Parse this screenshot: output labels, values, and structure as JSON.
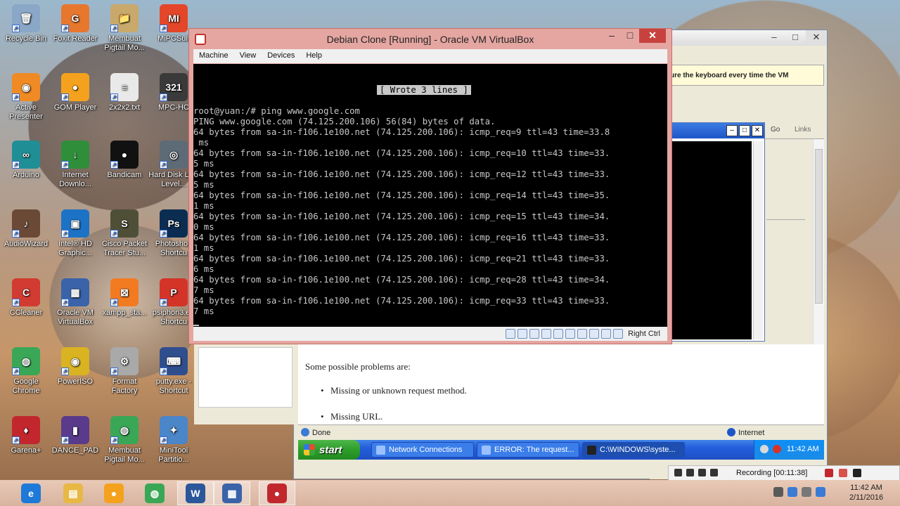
{
  "desktop": {
    "icons": [
      {
        "label": "Recycle Bin",
        "color": "#8aa7c7",
        "glyph": "🗑"
      },
      {
        "label": "Foxit Reader",
        "color": "#e8772e",
        "glyph": "G"
      },
      {
        "label": "Membuat Pigtail Mo...",
        "color": "#c9a96b",
        "glyph": "📁"
      },
      {
        "label": "MiPCSuit",
        "color": "#e4462a",
        "glyph": "MI"
      },
      {
        "label": "Active Presenter",
        "color": "#f08a24",
        "glyph": "◉"
      },
      {
        "label": "GOM Player",
        "color": "#f4a21d",
        "glyph": "●"
      },
      {
        "label": "2x2x2.txt",
        "color": "#e9e9e9",
        "glyph": "≡"
      },
      {
        "label": "MPC-HC",
        "color": "#3a3a3a",
        "glyph": "321"
      },
      {
        "label": "Arduino",
        "color": "#1f8f95",
        "glyph": "∞"
      },
      {
        "label": "Internet Downlo...",
        "color": "#2e8e3a",
        "glyph": "↓"
      },
      {
        "label": "Bandicam",
        "color": "#111111",
        "glyph": "●"
      },
      {
        "label": "Hard Disk Low Level...",
        "color": "#5d6b76",
        "glyph": "◎"
      },
      {
        "label": "AudioWizard",
        "color": "#6a4a36",
        "glyph": "♪"
      },
      {
        "label": "Intel® HD Graphic...",
        "color": "#1c73c5",
        "glyph": "▣"
      },
      {
        "label": "Cisco Packet Tracer Stu...",
        "color": "#4f4f38",
        "glyph": "S"
      },
      {
        "label": "Photoshop Shortcu",
        "color": "#0b2d52",
        "glyph": "Ps"
      },
      {
        "label": "CCleaner",
        "color": "#d13b31",
        "glyph": "C"
      },
      {
        "label": "Oracle VM VirtualBox",
        "color": "#3a63a9",
        "glyph": "▦"
      },
      {
        "label": "xampp_sta...",
        "color": "#f27b22",
        "glyph": "⊠"
      },
      {
        "label": "psiphon3.e - Shortcu",
        "color": "#d43428",
        "glyph": "P"
      },
      {
        "label": "Google Chrome",
        "color": "#3aa757",
        "glyph": "◍"
      },
      {
        "label": "PowerISO",
        "color": "#d9b321",
        "glyph": "◉"
      },
      {
        "label": "Format Factory",
        "color": "#a9a9a9",
        "glyph": "⚙"
      },
      {
        "label": "putty.exe - Shortcut",
        "color": "#2f4e8e",
        "glyph": "⌨"
      },
      {
        "label": "Garena+",
        "color": "#c1272d",
        "glyph": "♦"
      },
      {
        "label": "DANCE_PAD",
        "color": "#5a3a8a",
        "glyph": "▮"
      },
      {
        "label": "Membuat Pigtail Mo...",
        "color": "#3aa757",
        "glyph": "◍"
      },
      {
        "label": "MiniTool Partitio...",
        "color": "#4a86c8",
        "glyph": "✦"
      }
    ]
  },
  "vbox": {
    "title": "Debian Clone [Running] - Oracle VM VirtualBox",
    "menu": [
      "Machine",
      "View",
      "Devices",
      "Help"
    ],
    "wrote": "[ Wrote 3 lines ]",
    "console_lines": [
      "root@yuan:/# ping www.google.com",
      "PING www.google.com (74.125.200.106) 56(84) bytes of data.",
      "64 bytes from sa-in-f106.1e100.net (74.125.200.106): icmp_req=9 ttl=43 time=33.8",
      " ms",
      "64 bytes from sa-in-f106.1e100.net (74.125.200.106): icmp_req=10 ttl=43 time=33.",
      "5 ms",
      "64 bytes from sa-in-f106.1e100.net (74.125.200.106): icmp_req=12 ttl=43 time=33.",
      "5 ms",
      "64 bytes from sa-in-f106.1e100.net (74.125.200.106): icmp_req=14 ttl=43 time=35.",
      "1 ms",
      "64 bytes from sa-in-f106.1e100.net (74.125.200.106): icmp_req=15 ttl=43 time=34.",
      "0 ms",
      "64 bytes from sa-in-f106.1e100.net (74.125.200.106): icmp_req=16 ttl=43 time=33.",
      "1 ms",
      "64 bytes from sa-in-f106.1e100.net (74.125.200.106): icmp_req=21 ttl=43 time=33.",
      "6 ms",
      "64 bytes from sa-in-f106.1e100.net (74.125.200.106): icmp_req=28 ttl=43 time=34.",
      "7 ms",
      "64 bytes from sa-in-f106.1e100.net (74.125.200.106): icmp_req=33 ttl=43 time=33.",
      "7 ms"
    ],
    "host_key": "Right Ctrl"
  },
  "background_window": {
    "infobar_text": "ure the keyboard every time the VM",
    "go": "Go",
    "links": "Links",
    "page_intro": "Some possible problems are:",
    "page_items": [
      "Missing or unknown request method.",
      "Missing URL."
    ],
    "status_done": "Done",
    "status_zone": "Internet"
  },
  "xp_taskbar": {
    "start": "start",
    "tasks": [
      "Network Connections",
      "ERROR: The request...",
      "C:\\WINDOWS\\syste..."
    ],
    "time": "11:42 AM"
  },
  "recording": {
    "label": "Recording [00:11:38]"
  },
  "win_taskbar": {
    "apps": [
      {
        "name": "IE",
        "color": "#1e7ad8",
        "glyph": "e"
      },
      {
        "name": "Explorer",
        "color": "#e8b844",
        "glyph": "▤"
      },
      {
        "name": "GOM",
        "color": "#f4a21d",
        "glyph": "●"
      },
      {
        "name": "Chrome",
        "color": "#3aa757",
        "glyph": "◍"
      },
      {
        "name": "Word",
        "color": "#2b579a",
        "glyph": "W"
      },
      {
        "name": "VirtualBox",
        "color": "#3a63a9",
        "glyph": "▦"
      },
      {
        "name": "Bandicam",
        "color": "#c1272d",
        "glyph": "●"
      }
    ],
    "time": "11:42 AM",
    "date": "2/11/2016"
  }
}
